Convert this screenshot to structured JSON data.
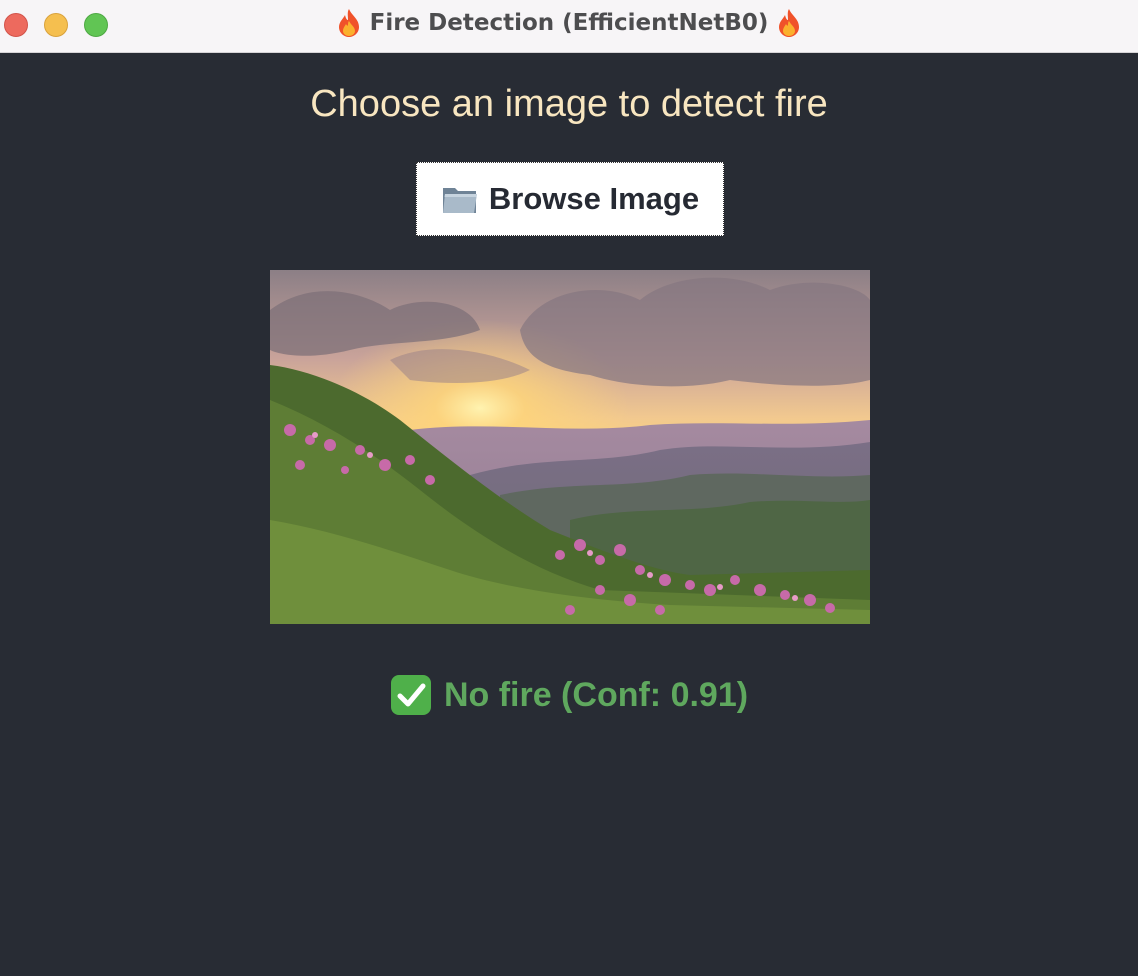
{
  "window": {
    "title": "Fire Detection (EfficientNetB0)",
    "title_icon": "fire-icon"
  },
  "main": {
    "heading": "Choose an image to detect fire",
    "browse_button": {
      "label": "Browse Image",
      "icon": "folder-icon"
    },
    "preview_image": {
      "description": "landscape-photo"
    },
    "result": {
      "text": "No fire (Conf: 0.91)",
      "icon": "check-mark-icon",
      "color": "#5fa85e"
    }
  },
  "colors": {
    "background": "#282c34",
    "heading": "#f8e6c0",
    "button_bg": "#ffffff",
    "titlebar": "#f7f5f7"
  }
}
